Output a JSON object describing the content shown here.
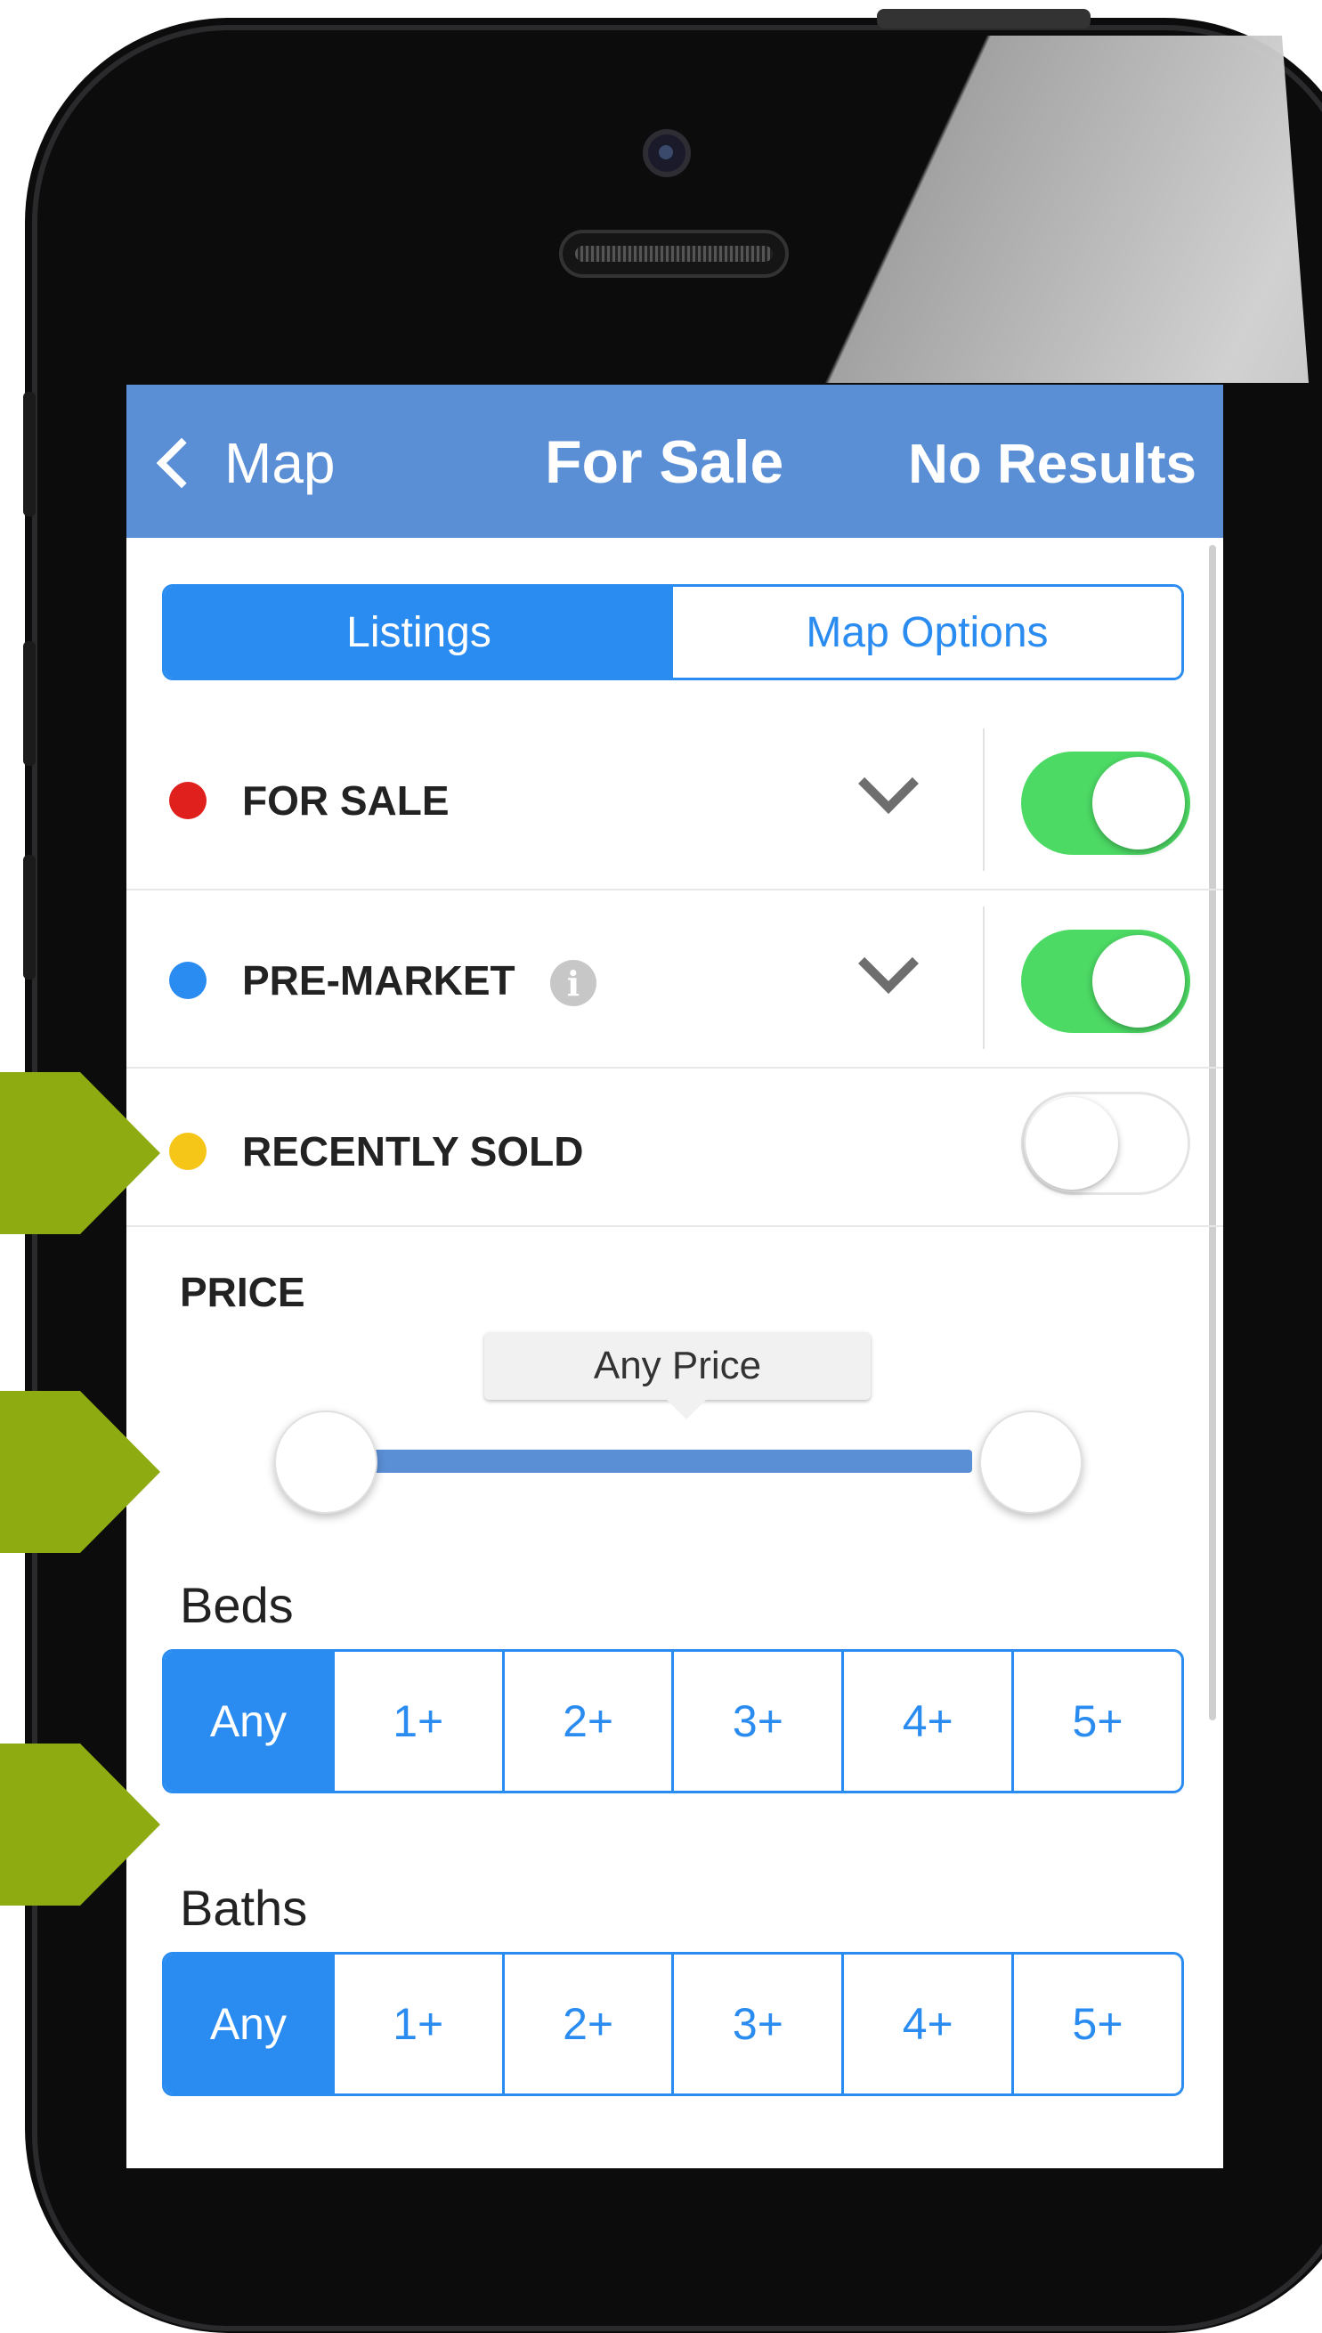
{
  "nav": {
    "back_label": "Map",
    "title": "For Sale",
    "right_label": "No Results"
  },
  "tabs": [
    {
      "label": "Listings",
      "active": true
    },
    {
      "label": "Map Options",
      "active": false
    }
  ],
  "listing_types": [
    {
      "label": "FOR SALE",
      "color": "#e0201c",
      "on": true,
      "expandable": true
    },
    {
      "label": "PRE-MARKET",
      "color": "#2a8cf0",
      "on": true,
      "expandable": true,
      "info_icon": "i"
    },
    {
      "label": "RECENTLY SOLD",
      "color": "#f5c518",
      "on": false,
      "expandable": false
    }
  ],
  "price": {
    "heading": "PRICE",
    "range_label": "Any Price"
  },
  "beds": {
    "heading": "Beds",
    "options": [
      "Any",
      "1+",
      "2+",
      "3+",
      "4+",
      "5+"
    ],
    "selected": "Any"
  },
  "baths": {
    "heading": "Baths",
    "options": [
      "Any",
      "1+",
      "2+",
      "3+",
      "4+",
      "5+"
    ],
    "selected": "Any"
  },
  "colors": {
    "nav": "#5a8fd6",
    "accent": "#2a8cf0",
    "toggle_on": "#4cd964",
    "annotation": "#8eab12"
  }
}
